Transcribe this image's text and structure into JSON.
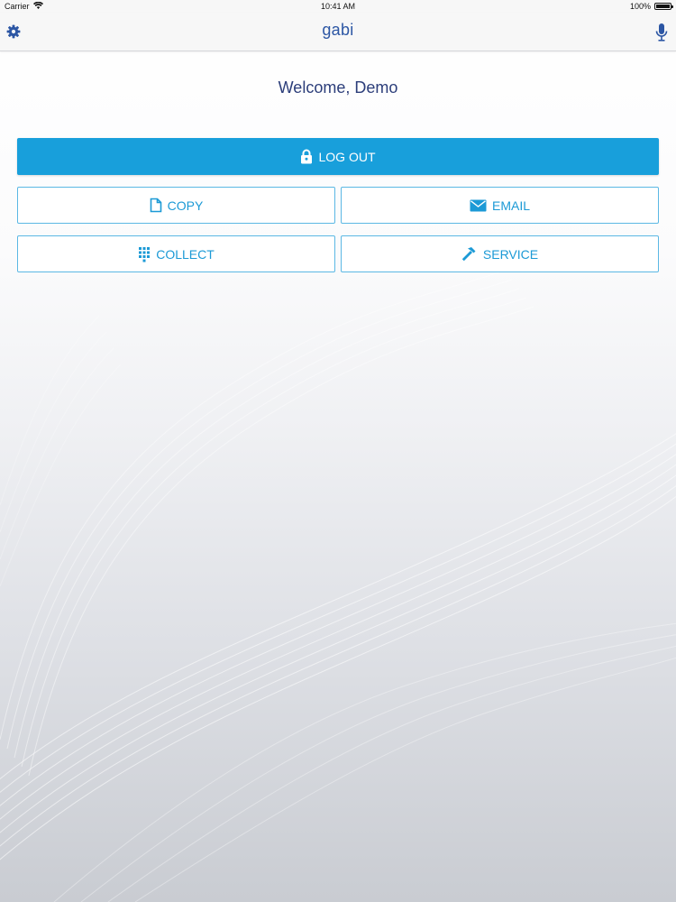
{
  "status_bar": {
    "carrier": "Carrier",
    "time": "10:41 AM",
    "battery": "100%",
    "battery_level": 1.0
  },
  "nav": {
    "title": "gabi",
    "left_icon": "gear-icon",
    "right_icon": "microphone-icon"
  },
  "welcome": {
    "text": "Welcome, Demo"
  },
  "actions": {
    "logout": {
      "label": "LOG OUT",
      "icon": "lock-icon"
    },
    "copy": {
      "label": "COPY",
      "icon": "document-icon"
    },
    "email": {
      "label": "EMAIL",
      "icon": "envelope-icon"
    },
    "collect": {
      "label": "COLLECT",
      "icon": "keypad-icon"
    },
    "service": {
      "label": "SERVICE",
      "icon": "hammer-icon"
    }
  },
  "colors": {
    "primary": "#189fdb",
    "nav_title": "#2c56a4",
    "welcome_text": "#2c3e7a",
    "outline_border": "#5bb8e4",
    "outline_text": "#1c9ad6",
    "nav_background": "#f7f7f7"
  }
}
